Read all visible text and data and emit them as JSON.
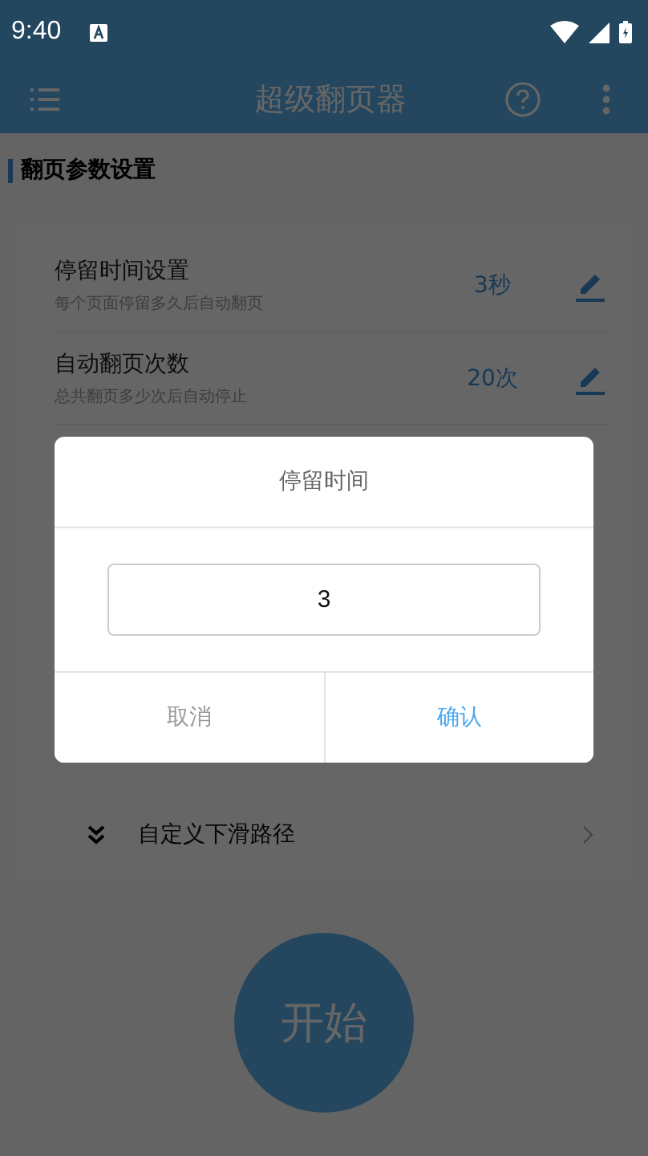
{
  "status_bar": {
    "time": "9:40"
  },
  "app_bar": {
    "title": "超级翻页器"
  },
  "section": {
    "title": "翻页参数设置"
  },
  "settings": [
    {
      "kind": "value",
      "title": "停留时间设置",
      "subtitle": "每个页面停留多久后自动翻页",
      "value": "3秒"
    },
    {
      "kind": "value",
      "title": "自动翻页次数",
      "subtitle": "总共翻页多少次后自动停止",
      "value": "20次"
    },
    {
      "kind": "link",
      "title": "自定义下滑路径"
    }
  ],
  "start_button": {
    "label": "开始"
  },
  "dialog": {
    "title": "停留时间",
    "input_value": "3",
    "buttons": [
      {
        "kind": "cancel",
        "label": "取消"
      },
      {
        "kind": "confirm",
        "label": "确认"
      }
    ]
  }
}
